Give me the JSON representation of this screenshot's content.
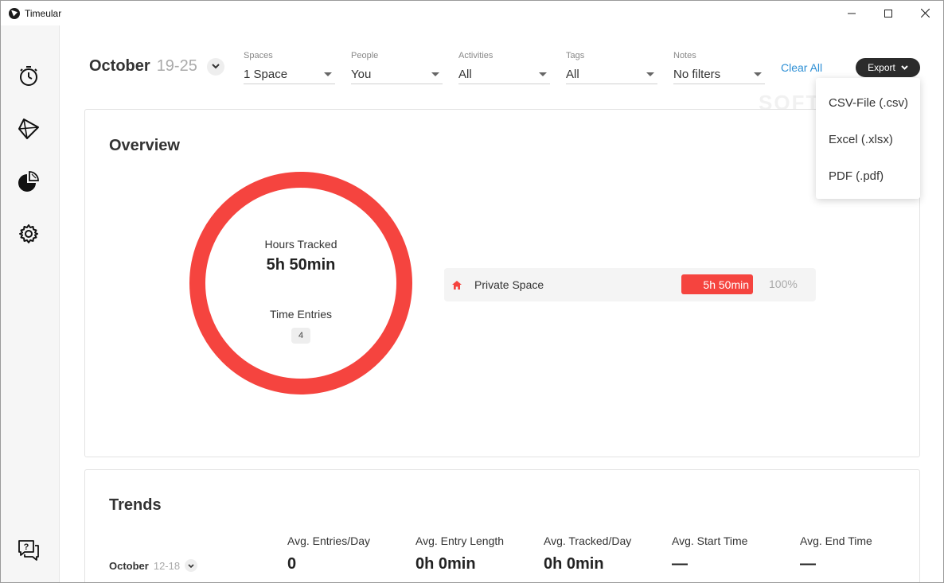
{
  "window": {
    "title": "Timeular"
  },
  "sidebar": {
    "items": [
      {
        "name": "stopwatch-icon"
      },
      {
        "name": "octahedron-icon"
      },
      {
        "name": "pie-chart-icon"
      },
      {
        "name": "gear-icon"
      },
      {
        "name": "help-chat-icon"
      }
    ]
  },
  "period": {
    "month": "October",
    "range": "19-25"
  },
  "filters": [
    {
      "label": "Spaces",
      "value": "1 Space"
    },
    {
      "label": "People",
      "value": "You"
    },
    {
      "label": "Activities",
      "value": "All"
    },
    {
      "label": "Tags",
      "value": "All"
    },
    {
      "label": "Notes",
      "value": "No filters"
    }
  ],
  "clear_all_label": "Clear All",
  "export": {
    "label": "Export",
    "menu": [
      "CSV-File (.csv)",
      "Excel (.xlsx)",
      "PDF (.pdf)"
    ]
  },
  "overview": {
    "title": "Overview",
    "hours_label": "Hours Tracked",
    "hours_value": "5h 50min",
    "entries_label": "Time Entries",
    "entries_count": "4",
    "spaces": [
      {
        "name": "Private Space",
        "duration": "5h 50min",
        "percent": "100%",
        "share": 1.0
      }
    ]
  },
  "trends": {
    "title": "Trends",
    "compare_month": "October",
    "compare_range": "12-18",
    "metrics": [
      {
        "label": "Avg. Entries/Day",
        "value": "0"
      },
      {
        "label": "Avg. Entry Length",
        "value": "0h 0min"
      },
      {
        "label": "Avg. Tracked/Day",
        "value": "0h 0min"
      },
      {
        "label": "Avg. Start Time",
        "value": "—"
      },
      {
        "label": "Avg. End Time",
        "value": "—"
      }
    ]
  },
  "colors": {
    "accent": "#f5443f",
    "link": "#2d8fd5",
    "dark": "#2b2b2b"
  },
  "watermark": "SOFTPEDIA"
}
